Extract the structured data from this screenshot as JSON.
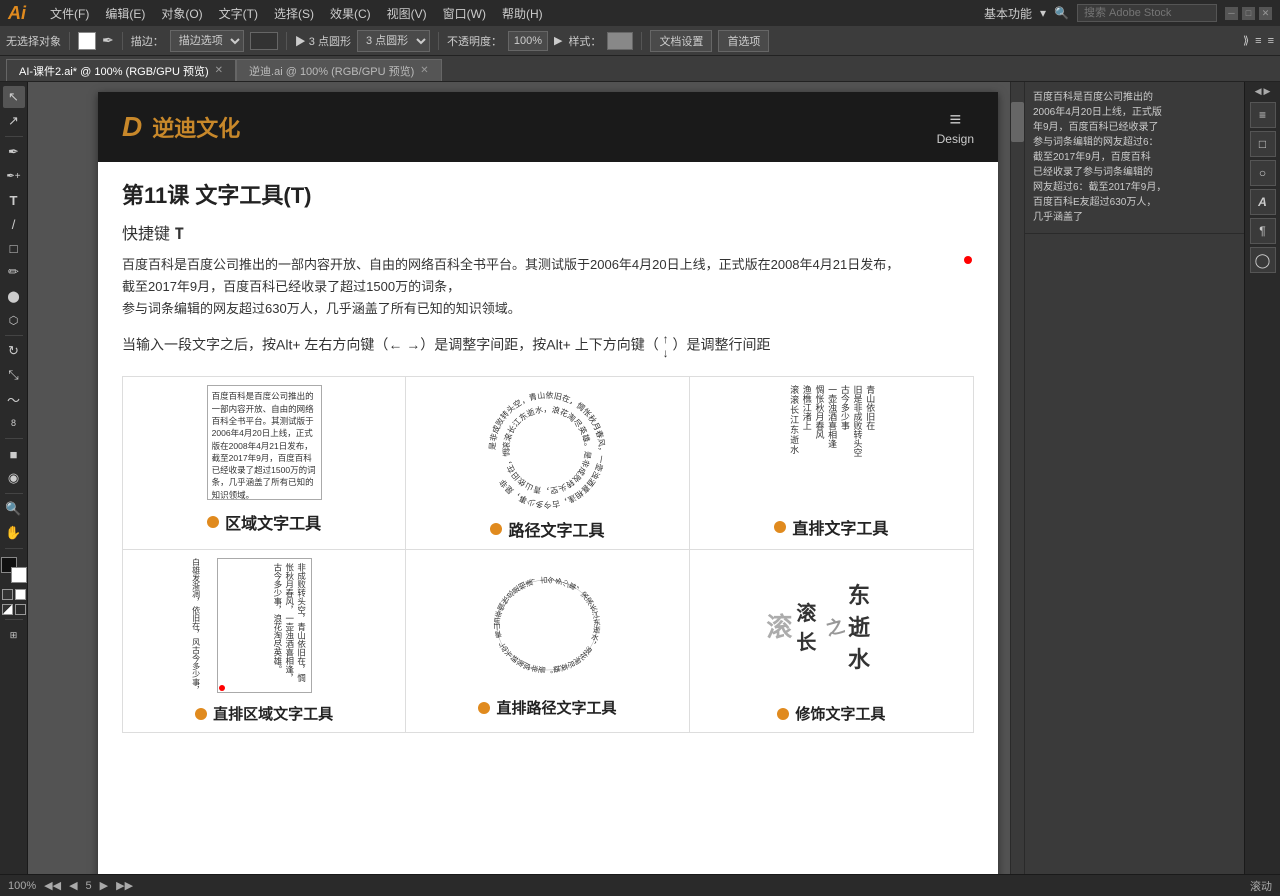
{
  "app": {
    "icon": "Ai",
    "menus": [
      "文件(F)",
      "编辑(E)",
      "对象(O)",
      "文字(T)",
      "选择(S)",
      "效果(C)",
      "视图(V)",
      "窗口(W)",
      "帮助(H)"
    ]
  },
  "toolbar": {
    "no_selection": "无选择对象",
    "stroke_label": "描边：",
    "points_label": "▶ 3 点圆形",
    "opacity_label": "不透明度：",
    "opacity_value": "100%",
    "style_label": "样式：",
    "doc_settings": "文档设置",
    "preferences": "首选项",
    "basic_func": "基本功能",
    "search_placeholder": "搜索 Adobe Stock"
  },
  "tabs": [
    {
      "label": "AI-课件2.ai* @ 100% (RGB/GPU 预览)",
      "active": true
    },
    {
      "label": "逆迪.ai @ 100% (RGB/GPU 预览)",
      "active": false
    }
  ],
  "document": {
    "logo_icon": "D",
    "logo_text": "逆迪文化",
    "menu_icon": "≡",
    "menu_label": "Design",
    "lesson_title": "第11课   文字工具(T)",
    "shortcut": "快捷键 T",
    "description_lines": [
      "百度百科是百度公司推出的一部内容开放、自由的网络百科全书平台。其测试版于2006年4月20日上线，正式版在2008年4月21日发布，",
      "截至2017年9月，百度百科已经收录了超过1500万的词条，",
      "参与词条编辑的网友超过630万人，几乎涵盖了所有已知的知识领域。"
    ],
    "hint_text": "当输入一段文字之后，按Alt+ 左右方向键（← →）是调整字间距，按Alt+ 上下方向键（",
    "hint_end": "）是调整行间距",
    "tools": [
      {
        "name": "区域文字工具",
        "demo_type": "area",
        "text": "百度百科是百度公司推出的一部内容开放、自由的网络百科全书平台。其测试版于2006年4月20日上线，正式版在2008年4月21日发布，截至2017年9月，百度百科已经收录了超过1500万的词条，几乎涵盖了所有已知的知识领域。"
      },
      {
        "name": "路径文字工具",
        "demo_type": "path",
        "text": "是非成败转头空，青山依旧在，惆怅秋月春风，一壶浊酒喜相逢，古今多少事，滚滚长江东逝水，浪花淘尽英雄。是非成败转头空，青山依旧在"
      },
      {
        "name": "直排文字工具",
        "demo_type": "vertical",
        "text": "滚滚长江东逝水，渔樵江渚上，惆怅秋月春风，一壶浊酒喜相逢，古今多少事，旧是非成败转头空，青山依旧在"
      }
    ],
    "bottom_tools": [
      {
        "name": "直排区域文字工具"
      },
      {
        "name": "直排路径文字工具"
      },
      {
        "name": "修饰文字工具"
      }
    ]
  },
  "right_panel": {
    "text": "百度百科是百度公司推出的2006年4月20日上线，正式版年9月，百度百科已经收录了参与词条编辑的网友超过6：截至2017年9月，百度百科已经收录了参与词条编辑的网友超过6：截至2017年9月，百度百科E友超过630万人，几乎涵盖了"
  },
  "bottom_bar": {
    "zoom": "100%",
    "page_info": "5",
    "status": "滚动"
  },
  "icons": {
    "select": "↖",
    "direct_select": "↗",
    "lasso": "⬡",
    "pen": "✒",
    "text": "T",
    "line": "/",
    "shape": "□",
    "pencil": "✏",
    "rotate": "↻",
    "scale": "⤡",
    "warp": "~",
    "gradient": "■",
    "eyedropper": "◉",
    "blend": "∞",
    "zoom": "🔍",
    "hand": "✋"
  }
}
